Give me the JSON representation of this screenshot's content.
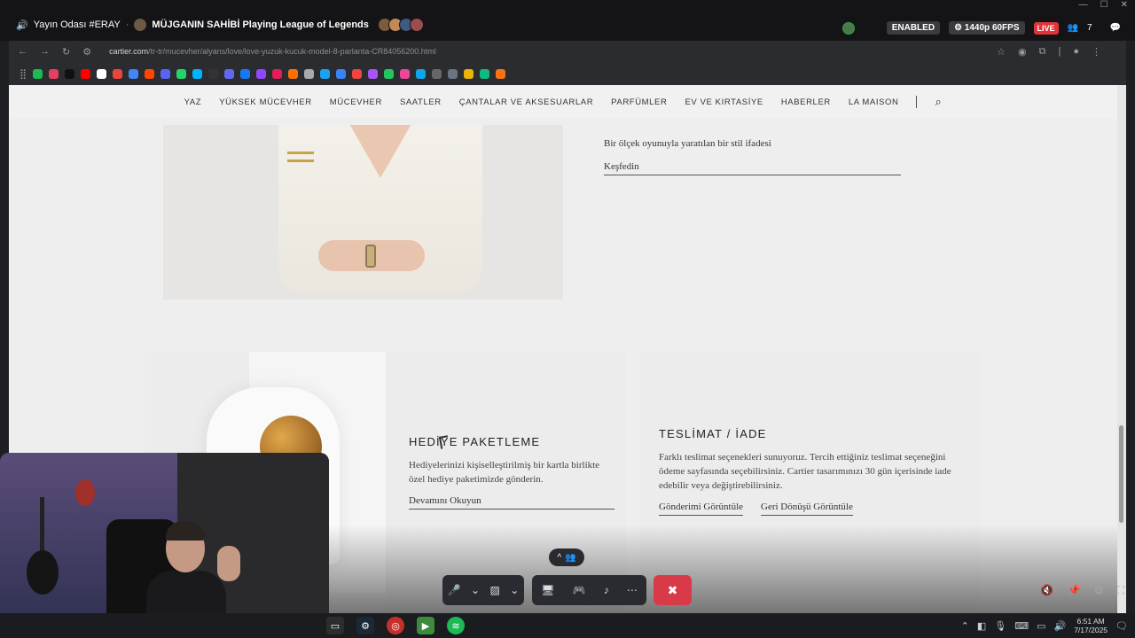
{
  "stream": {
    "channel": "Yayın Odası #ERAY",
    "separator": "·",
    "player": "MÜJGANIN SAHİBİ Playing League of Legends",
    "enabled": "ENABLED",
    "quality": "⚙ 1440p 60FPS",
    "live": "LIVE",
    "viewers": "7",
    "viewers_icon": "people-icon"
  },
  "browser": {
    "url_host": "cartier.com",
    "url_path": "/tr-tr/mucevher/alyans/love/love-yuzuk-kucuk-model-8-parlanta-CR84056200.html",
    "bookmark_colors": [
      "#1db954",
      "#e4405f",
      "#111111",
      "#ff0000",
      "#ffffff",
      "#e8453c",
      "#4285f4",
      "#ff4500",
      "#5865f2",
      "#25d366",
      "#00b2ff",
      "#333333",
      "#6366f1",
      "#1877f2",
      "#9146ff",
      "#e01e5a",
      "#ff6f00",
      "#aaaaaa",
      "#1da1f2",
      "#3b82f6",
      "#ef4444",
      "#a855f7",
      "#22c55e",
      "#ec4899",
      "#0ea5e9",
      "#666666",
      "#6b7280",
      "#eab308",
      "#10b981",
      "#f97316"
    ]
  },
  "nav": {
    "items": [
      "YAZ",
      "YÜKSEK MÜCEVHER",
      "MÜCEVHER",
      "SAATLER",
      "ÇANTALAR VE AKSESUARLAR",
      "PARFÜMLER",
      "EV VE KIRTASİYE",
      "HABERLER",
      "LA MAISON"
    ],
    "search_icon": "search-icon"
  },
  "hero": {
    "text": "Bir ölçek oyunuyla yaratılan bir stil ifadesi",
    "link": "Keşfedin"
  },
  "gift": {
    "title": "HEDİYE PAKETLEME",
    "body": "Hediyelerinizi kişiselleştirilmiş bir kartla birlikte özel hediye paketimizde gönderin.",
    "link": "Devamını Okuyun"
  },
  "delivery": {
    "title": "TESLİMAT / İADE",
    "body": "Farklı teslimat seçenekleri sunuyoruz. Tercih ettiğiniz teslimat seçeneğini ödeme sayfasında seçebilirsiniz. Cartier tasarımınızı 30 gün içerisinde iade edebilir veya değiştirebilirsiniz.",
    "link1": "Gönderimi Görüntüle",
    "link2": "Geri Dönüşü Görüntüle"
  },
  "call_controls": {
    "mic": "🎤",
    "camera": "▨",
    "screen": "🖥",
    "activity": "🎮",
    "soundboard": "♪",
    "more": "⋯",
    "leave": "✖",
    "expand_up": "^",
    "expand_people": "👥"
  },
  "taskbar": {
    "time": "6:51 AM",
    "date": "7/17/2025"
  }
}
